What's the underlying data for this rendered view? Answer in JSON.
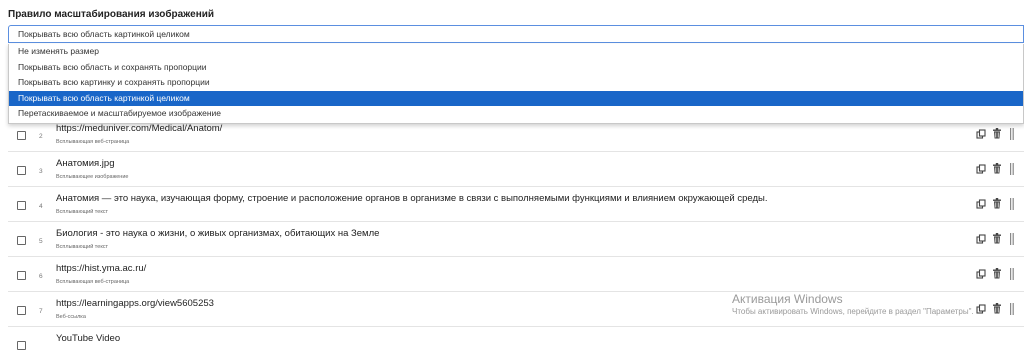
{
  "section": {
    "title": "Правило масштабирования изображений",
    "selected_value": "Покрывать всю область картинкой целиком"
  },
  "dropdown": {
    "options": [
      "Не изменять размер",
      "Покрывать всю область и сохранять пропорции",
      "Покрывать всю картинку и сохранять пропорции",
      "Покрывать всю область картинкой целиком",
      "Перетаскиваемое и масштабируемое изображение"
    ],
    "selected_index": 3
  },
  "items": [
    {
      "num": "2",
      "title": "https://meduniver.com/Medical/Anatom/",
      "type": "Всплывающая веб-страница"
    },
    {
      "num": "3",
      "title": "Анатомия.jpg",
      "type": "Всплывающее изображение"
    },
    {
      "num": "4",
      "title": "Анатомия — это наука, изучающая форму, строение и расположение органов в организме в связи с выполняемыми функциями и влиянием окружающей среды.",
      "type": "Всплывающий текст"
    },
    {
      "num": "5",
      "title": "Биология - это наука о жизни, о живых организмах, обитающих на Земле",
      "type": "Всплывающий текст"
    },
    {
      "num": "6",
      "title": "https://hist.yma.ac.ru/",
      "type": "Всплывающая веб-страница"
    },
    {
      "num": "7",
      "title": "https://learningapps.org/view5605253",
      "type": "Веб-ссылка"
    },
    {
      "num": "",
      "title": "YouTube Video",
      "type": ""
    }
  ],
  "watermark": {
    "title": "Активация Windows",
    "subtitle": "Чтобы активировать Windows, перейдите в раздел \"Параметры\"."
  },
  "colors": {
    "selected_bg": "#1966c8",
    "focus_border": "#5b8fe0"
  }
}
